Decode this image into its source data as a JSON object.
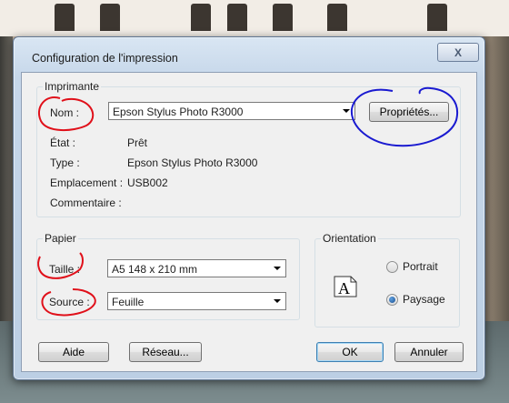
{
  "dialog": {
    "title": "Configuration de l'impression",
    "close_symbol": "X"
  },
  "printer": {
    "group_label": "Imprimante",
    "name_label": "Nom :",
    "name_value": "Epson Stylus Photo R3000",
    "properties_button": "Propriétés...",
    "status_label": "État :",
    "status_value": "Prêt",
    "type_label": "Type :",
    "type_value": "Epson Stylus Photo R3000",
    "location_label": "Emplacement :",
    "location_value": "USB002",
    "comment_label": "Commentaire :"
  },
  "paper": {
    "group_label": "Papier",
    "size_label": "Taille :",
    "size_value": "A5 148 x 210 mm",
    "source_label": "Source :",
    "source_value": "Feuille"
  },
  "orientation": {
    "group_label": "Orientation",
    "icon_letter": "A",
    "options": [
      {
        "label": "Portrait",
        "selected": false
      },
      {
        "label": "Paysage",
        "selected": true
      }
    ]
  },
  "buttons": {
    "help": "Aide",
    "network": "Réseau...",
    "ok": "OK",
    "cancel": "Annuler"
  },
  "annotations": {
    "red_color": "#e0101a",
    "blue_color": "#1a1ad0"
  }
}
